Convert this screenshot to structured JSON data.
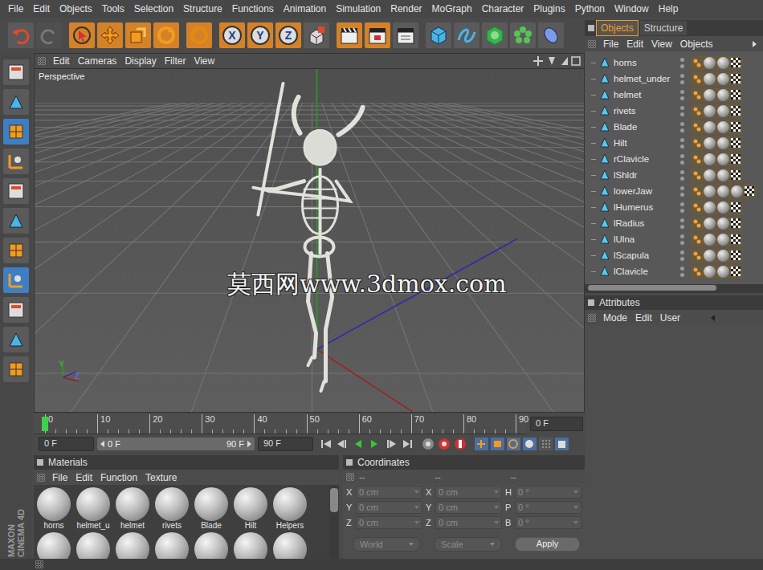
{
  "menu_bar": [
    "File",
    "Edit",
    "Objects",
    "Tools",
    "Selection",
    "Structure",
    "Functions",
    "Animation",
    "Simulation",
    "Render",
    "MoGraph",
    "Character",
    "Plugins",
    "Python",
    "Window",
    "Help"
  ],
  "toolbar": {
    "axis_buttons": [
      "X",
      "Y",
      "Z"
    ]
  },
  "left_tools": [
    {
      "selected": false
    },
    {
      "selected": false
    },
    {
      "selected": true
    },
    {
      "selected": false
    },
    {
      "selected": false
    },
    {
      "selected": false
    },
    {
      "selected": false
    },
    {
      "selected": true
    },
    {
      "selected": false
    },
    {
      "selected": false
    },
    {
      "selected": false
    }
  ],
  "logo": [
    "MAXON",
    "CINEMA 4D"
  ],
  "viewport": {
    "menu": [
      "Edit",
      "Cameras",
      "Display",
      "Filter",
      "View"
    ],
    "camera_label": "Perspective",
    "watermark": "莫西网www.3dmox.com",
    "axis_labels": [
      "Y",
      "Z"
    ]
  },
  "timeline": {
    "ticks": [
      "0",
      "10",
      "20",
      "30",
      "40",
      "50",
      "60",
      "70",
      "80",
      "90"
    ],
    "playhead": 0,
    "frame_field": "0 F"
  },
  "transport": {
    "start_field": "0 F",
    "range_start": "0 F",
    "range_end": "90 F",
    "end_field": "90 F"
  },
  "materials": {
    "title": "Materials",
    "menu": [
      "File",
      "Edit",
      "Function",
      "Texture"
    ],
    "items": [
      {
        "name": "horns"
      },
      {
        "name": "helmet_u"
      },
      {
        "name": "helmet"
      },
      {
        "name": "rivets"
      },
      {
        "name": "Blade"
      },
      {
        "name": "Hilt"
      },
      {
        "name": "Helpers"
      }
    ],
    "partial_row_count": 7
  },
  "coordinates": {
    "title": "Coordinates",
    "headers": [
      "--",
      "--",
      "--"
    ],
    "disabled": true,
    "rows": [
      [
        {
          "label": "X",
          "value": "0 cm"
        },
        {
          "label": "X",
          "value": "0 cm"
        },
        {
          "label": "H",
          "value": "0 °"
        }
      ],
      [
        {
          "label": "Y",
          "value": "0 cm"
        },
        {
          "label": "Y",
          "value": "0 cm"
        },
        {
          "label": "P",
          "value": "0 °"
        }
      ],
      [
        {
          "label": "Z",
          "value": "0 cm"
        },
        {
          "label": "Z",
          "value": "0 cm"
        },
        {
          "label": "B",
          "value": "0 °"
        }
      ]
    ],
    "dropdowns": [
      "World",
      "Scale"
    ],
    "apply": "Apply"
  },
  "objects_panel": {
    "tabs": [
      {
        "label": "Objects",
        "selected": true
      },
      {
        "label": "Structure",
        "selected": false
      }
    ],
    "menu": [
      "File",
      "Edit",
      "View",
      "Objects"
    ],
    "rows": [
      {
        "name": "horns",
        "tags": 2
      },
      {
        "name": "helmet_under",
        "tags": 2
      },
      {
        "name": "helmet",
        "tags": 2
      },
      {
        "name": "rivets",
        "tags": 2
      },
      {
        "name": "Blade",
        "tags": 2
      },
      {
        "name": "Hilt",
        "tags": 2
      },
      {
        "name": "rClavicle",
        "tags": 2
      },
      {
        "name": "lShldr",
        "tags": 2
      },
      {
        "name": "lowerJaw",
        "tags": 3
      },
      {
        "name": "lHumerus",
        "tags": 2
      },
      {
        "name": "lRadius",
        "tags": 2
      },
      {
        "name": "lUlna",
        "tags": 2
      },
      {
        "name": "lScapula",
        "tags": 2
      },
      {
        "name": "lClavicle",
        "tags": 2
      }
    ]
  },
  "attributes": {
    "title": "Attributes",
    "menu": [
      "Mode",
      "Edit",
      "User"
    ]
  }
}
